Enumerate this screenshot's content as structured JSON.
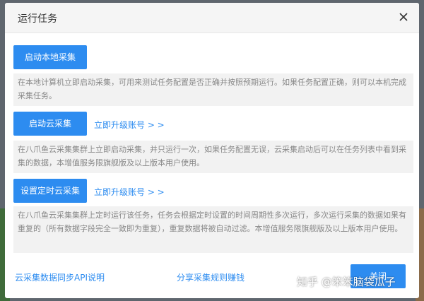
{
  "dialog": {
    "title": "运行任务",
    "close_icon": "close-icon"
  },
  "sections": {
    "local": {
      "button_label": "启动本地采集",
      "description": "在本地计算机立即启动采集，可用来测试任务配置是否正确并按照预期运行。如果任务配置正确，则可以本机完成采集任务。"
    },
    "cloud": {
      "button_label": "启动云采集",
      "upgrade_link": "立即升级账号 > >",
      "description": "在八爪鱼云采集集群上立即启动采集，并只运行一次，如果任务配置无误，云采集启动后可以在任务列表中看到采集的数据，本增值服务限旗舰版及以上版本用户使用。"
    },
    "scheduled": {
      "button_label": "设置定时云采集",
      "upgrade_link": "立即升级账号 > >",
      "description": "在八爪鱼云采集集群上定时运行该任务，任务会根据定时设置的时间周期性多次运行，多次运行采集的数据如果有重复的（所有数据字段完全一致即为重复），重复数据将被自动过滤。本增值服务限旗舰版及以上版本用户使用。"
    }
  },
  "footer": {
    "api_link": "云采集数据同步API说明",
    "share_link": "分享采集规则赚钱",
    "close_button": "关闭"
  },
  "watermark": "知乎 @笨笨脑袋瓜子",
  "colors": {
    "accent": "#2d8cf0",
    "description_bg": "#f2f2f2",
    "description_text": "#888888"
  }
}
